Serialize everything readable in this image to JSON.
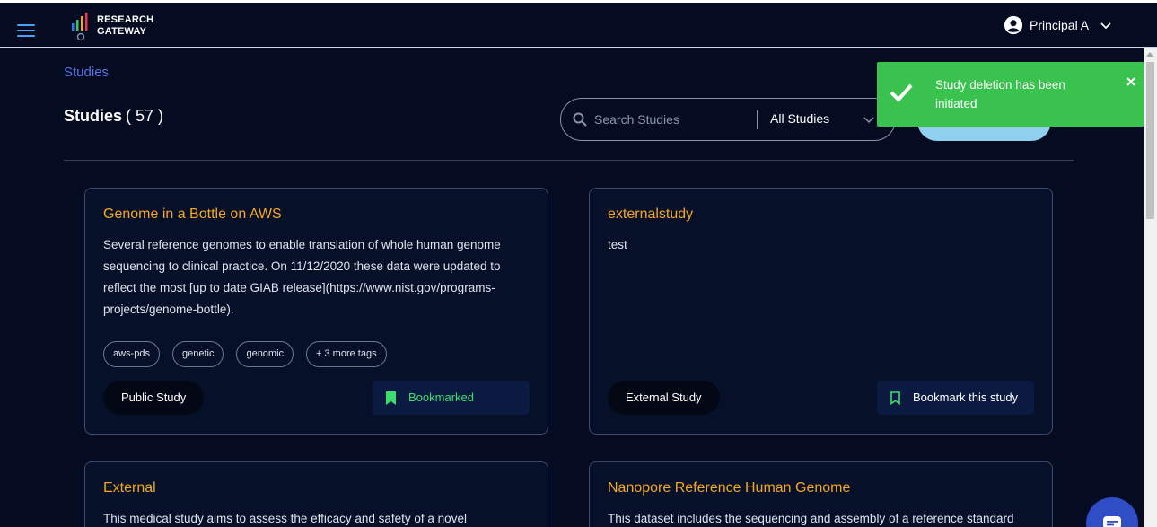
{
  "header": {
    "menu_icon": "hamburger-menu-icon",
    "logo_line1": "RESEARCH",
    "logo_line2": "GATEWAY",
    "user_name": "Principal A",
    "user_icon": "account-circle-icon",
    "dropdown_icon": "chevron-down-icon"
  },
  "breadcrumb": "Studies",
  "page": {
    "title": "Studies",
    "count": "( 57 )"
  },
  "search": {
    "placeholder": "Search Studies",
    "value": "",
    "filter_selected": "All Studies",
    "create_button_label": ""
  },
  "toast": {
    "message": "Study deletion has been initiated",
    "color": "#39c24d",
    "icon": "check-icon",
    "close_icon": "close-icon"
  },
  "studies": [
    {
      "title": "Genome in a Bottle on AWS",
      "description": "Several reference genomes to enable translation of whole human genome sequencing to clinical practice. On 11/12/2020 these data were updated to reflect the most [up to date GIAB release](https://www.nist.gov/programs-projects/genome-bottle).",
      "tags": [
        "aws-pds",
        "genetic",
        "genomic",
        "+ 3 more tags"
      ],
      "type": "Public Study",
      "bookmark_label": "Bookmarked",
      "bookmarked": true
    },
    {
      "title": "externalstudy",
      "description": "test",
      "tags": [],
      "type": "External Study",
      "bookmark_label": "Bookmark this study",
      "bookmarked": false
    },
    {
      "title": "External",
      "description": "This medical study aims to assess the efficacy and safety of a novel",
      "tags": [],
      "type": "",
      "bookmark_label": "",
      "bookmarked": false
    },
    {
      "title": "Nanopore Reference Human Genome",
      "description": "This dataset includes the sequencing and assembly of a reference standard",
      "tags": [],
      "type": "",
      "bookmark_label": "",
      "bookmarked": false
    }
  ],
  "colors": {
    "background": "#050c22",
    "card_title": "#f5a623",
    "bookmarked": "#3ddc6e",
    "link": "#5b73e8"
  },
  "chat_icon": "chat-bubble-icon"
}
